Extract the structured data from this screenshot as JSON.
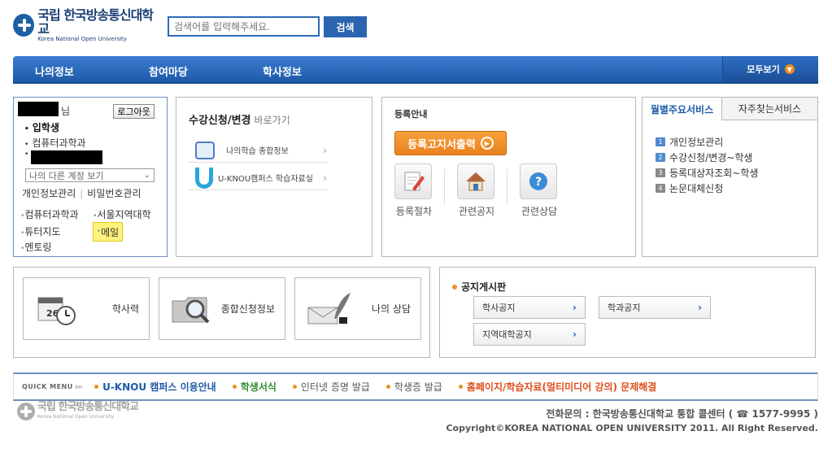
{
  "header": {
    "logo_ko": "국립 한국방송통신대학교",
    "logo_en": "Korea National Open University",
    "search_placeholder": "검색어를 입력해주세요.",
    "search_button": "검색"
  },
  "nav": {
    "items": [
      "나의정보",
      "참여마당",
      "학사정보"
    ],
    "all_label": "모두보기"
  },
  "user": {
    "honorific": "님",
    "logout": "로그아웃",
    "status": "입학생",
    "department": "컴퓨터과학과",
    "account_select": "나의 다른 계정 보기",
    "links": [
      "개인정보관리",
      "비밀번호관리"
    ],
    "quick_links": [
      "컴퓨터과학과",
      "서울지역대학",
      "튜터지도",
      "메일",
      "멘토링"
    ]
  },
  "course": {
    "title": "수강신청/변경",
    "subtitle": "바로가기",
    "items": [
      "나의학습 종합정보",
      "U-KNOU캠퍼스 학습자료실"
    ]
  },
  "registration": {
    "title": "등록안내",
    "print_button": "등록고지서출력",
    "items": [
      "등록절차",
      "관련공지",
      "관련상담"
    ]
  },
  "monthly": {
    "tabs": [
      "월별주요서비스",
      "자주찾는서비스"
    ],
    "items": [
      "개인정보관리",
      "수강신청/변경~학생",
      "등록대상자조회~학생",
      "논문대체신청"
    ]
  },
  "tiles": [
    "학사력",
    "종합신청정보",
    "나의 상담"
  ],
  "notice": {
    "title": "공지게시판",
    "buttons": [
      "학사공지",
      "학과공지",
      "지역대학공지"
    ]
  },
  "quick_menu": {
    "label": "QUICK MENU",
    "items": [
      {
        "text": "U-KNOU 캠퍼스 이용안내",
        "color": "#1e5aa8"
      },
      {
        "text": "학생서식",
        "color": "#2e8b2e"
      },
      {
        "text": "인터넷 증명 발급",
        "color": "#555555"
      },
      {
        "text": "학생증 발급",
        "color": "#555555"
      },
      {
        "text": "홈페이지/학습자료(멀티미디어 강의) 문제해결",
        "color": "#e0501e"
      }
    ]
  },
  "footer": {
    "phone": "전화문의 : 한국방송통신대학교 통합 콜센터 ( ☎ 1577-9995 )",
    "copyright": "Copyright©KOREA NATIONAL OPEN UNIVERSITY 2011. All Right Reserved."
  },
  "colors": {
    "primary": "#1e5aa8",
    "accent_orange": "#f0901e",
    "highlight": "#fff27a"
  }
}
